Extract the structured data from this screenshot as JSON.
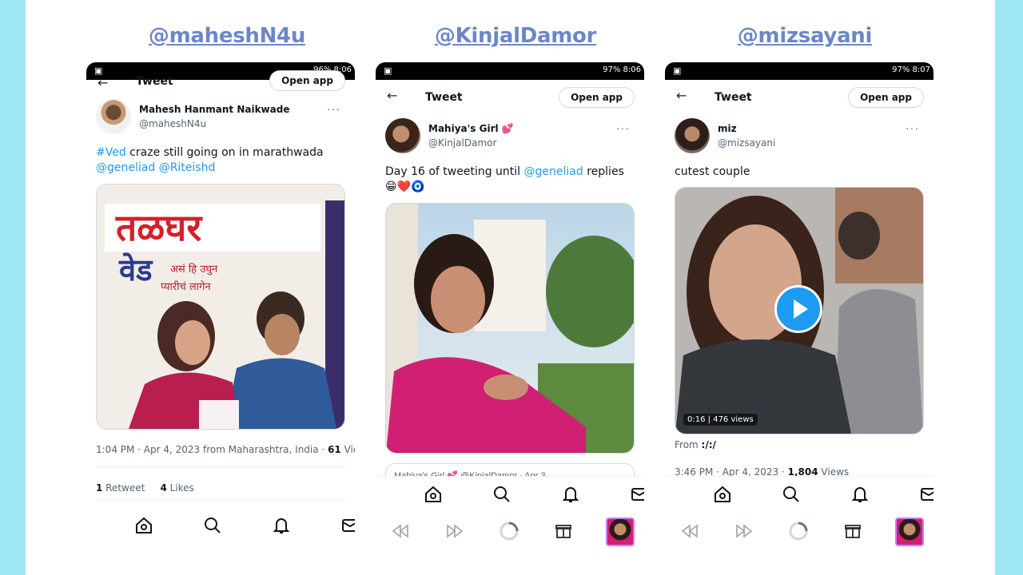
{
  "headers": [
    "@maheshN4u",
    "@KinjalDamor",
    "@mizsayani"
  ],
  "phones": [
    {
      "status_battery": "96% 8:06",
      "topbar": {
        "title": "Tweet",
        "open_app": "Open app"
      },
      "author": {
        "name": "Mahesh Hanmant Naikwade",
        "handle": "@maheshN4u"
      },
      "text": {
        "hashtag": "#Ved",
        "body": " craze still going on in marathwada",
        "mention1": "@geneliad",
        "mention2": "@Riteishd"
      },
      "poster_text": {
        "line1": "तळघर",
        "line2": "वेड",
        "line3": "असं हि उघुन",
        "line4": "प्यारीचं लागेन"
      },
      "meta": {
        "time": "1:04 PM · Apr 4, 2023 from Maharashtra, India · ",
        "views_num": "61",
        "views_label": " Vie"
      },
      "stats": {
        "retweets_num": "1",
        "retweets_label": " Retweet",
        "likes_num": "4",
        "likes_label": " Likes"
      }
    },
    {
      "status_battery": "97% 8:06",
      "topbar": {
        "title": "Tweet",
        "open_app": "Open app"
      },
      "author": {
        "name": "Mahiya's Girl 💕",
        "handle": "@KinjalDamor"
      },
      "text": {
        "body": "Day 16 of tweeting until ",
        "mention": "@geneliad",
        "tail": " replies",
        "emojis": "😁❤️🧿"
      },
      "quoted": "Mahiya's Girl 💕 @KinjalDamor · Apr 3"
    },
    {
      "status_battery": "97% 8:07",
      "topbar": {
        "title": "Tweet",
        "open_app": "Open app"
      },
      "author": {
        "name": "miz",
        "handle": "@mizsayani"
      },
      "text": {
        "body": "cutest couple"
      },
      "video": {
        "duration": "0:16",
        "views": "476 views"
      },
      "from": {
        "label": "From ",
        "value": ":/:/"
      },
      "meta": {
        "time": "3:46 PM · Apr 4, 2023 · ",
        "views_num": "1,804",
        "views_label": " Views"
      }
    }
  ],
  "icons": [
    "arrow-left-icon",
    "more-dots-icon",
    "home-icon",
    "search-icon",
    "bell-icon",
    "mail-icon",
    "play-icon",
    "rewind-icon",
    "fast-forward-icon",
    "spinner-icon",
    "gift-icon"
  ],
  "colors": {
    "background": "#9ee6f6",
    "header": "#6b87c9",
    "link": "#1d9bf0",
    "text": "#0f1419",
    "muted": "#536471"
  }
}
